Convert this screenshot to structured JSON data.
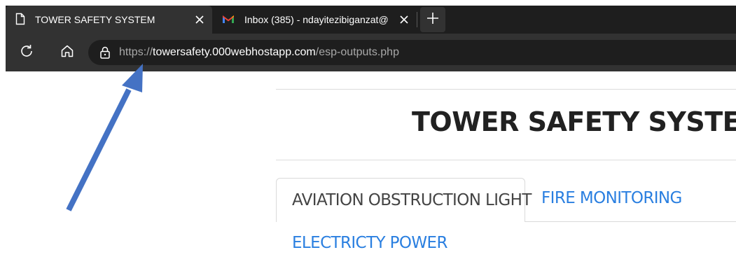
{
  "browser": {
    "tabs": [
      {
        "title": "TOWER SAFETY SYSTEM",
        "icon": "page-icon",
        "active": true
      },
      {
        "title": "Inbox (385) - ndayitezibiganzat@",
        "icon": "gmail-icon",
        "active": false
      }
    ],
    "new_tab_icon": "plus-icon",
    "toolbar": {
      "reload_icon": "reload-icon",
      "home_icon": "home-icon",
      "lock_icon": "lock-icon"
    },
    "address": {
      "scheme": "https://",
      "host": "towersafety.000webhostapp.com",
      "path": "/esp-outputs.php"
    }
  },
  "page": {
    "title": "TOWER SAFETY SYSTEM",
    "tabs": [
      {
        "label": "AVIATION OBSTRUCTION LIGHT",
        "active": true
      },
      {
        "label": "FIRE MONITORING",
        "active": false
      },
      {
        "label": "ELECTRICTY POWER",
        "active": false
      }
    ]
  },
  "annotation": {
    "arrow_color": "#4472c4"
  },
  "colors": {
    "chrome_dark": "#1e1e1e",
    "chrome_mid": "#323232",
    "link_blue": "#2a7fe0",
    "title_text": "#212121"
  }
}
